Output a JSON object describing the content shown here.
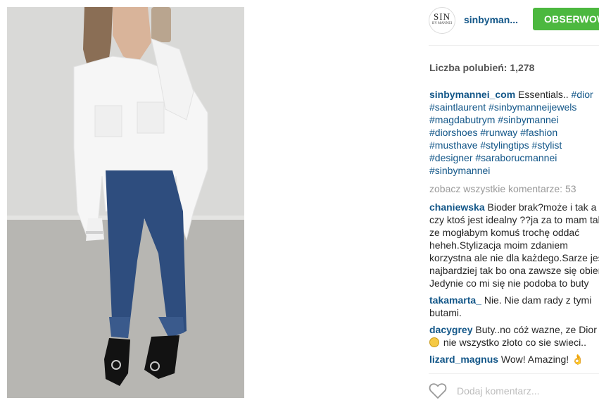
{
  "post": {
    "username": "sinbyman...",
    "avatar_text": "SIN",
    "avatar_subtext": "BY MANNEI",
    "follow_label": "OBSERWOWA",
    "likes_label": "Liczba polubień:",
    "likes_count": "1,278",
    "caption_user": "sinbymannei_com",
    "caption_text": " Essentials.. ",
    "hashtags": [
      "#dior",
      "#saintlaurent",
      "#sinbymanneijewels",
      "#magdabutrym",
      "#sinbymannei",
      "#diorshoes",
      "#runway",
      "#fashion",
      "#musthave",
      "#stylingtips",
      "#stylist",
      "#designer",
      "#saraborucmannei",
      "#sinbymannei"
    ],
    "view_all_label": "zobacz wszystkie komentarze: 53",
    "comments": [
      {
        "user": "chaniewska",
        "text": " Bioder brak?może i tak a czy ktoś jest idealny ??ja za to mam takie ze mogłabym komuś trochę oddać heheh.Stylizacja moim zdaniem korzystna ale nie dla każdego.Sarze jest najbardziej tak bo ona zawsze się obiera. Jedynie co mi się nie podoba to buty"
      },
      {
        "user": "takamarta_",
        "text": " Nie. Nie dam rady z tymi butami."
      },
      {
        "user": "dacygrey",
        "text": " Buty..no cóż wazne, ze Dior",
        "text2": " nie wszystko złoto co sie swieci.."
      },
      {
        "user": "lizard_magnus",
        "text": " Wow! Amazing! 👌"
      }
    ],
    "add_comment_placeholder": "Dodaj komentarz..."
  },
  "colors": {
    "link": "#125688",
    "follow_bg": "#4cb83f",
    "muted": "#999999"
  },
  "icons": {
    "like": "heart-outline-icon"
  }
}
